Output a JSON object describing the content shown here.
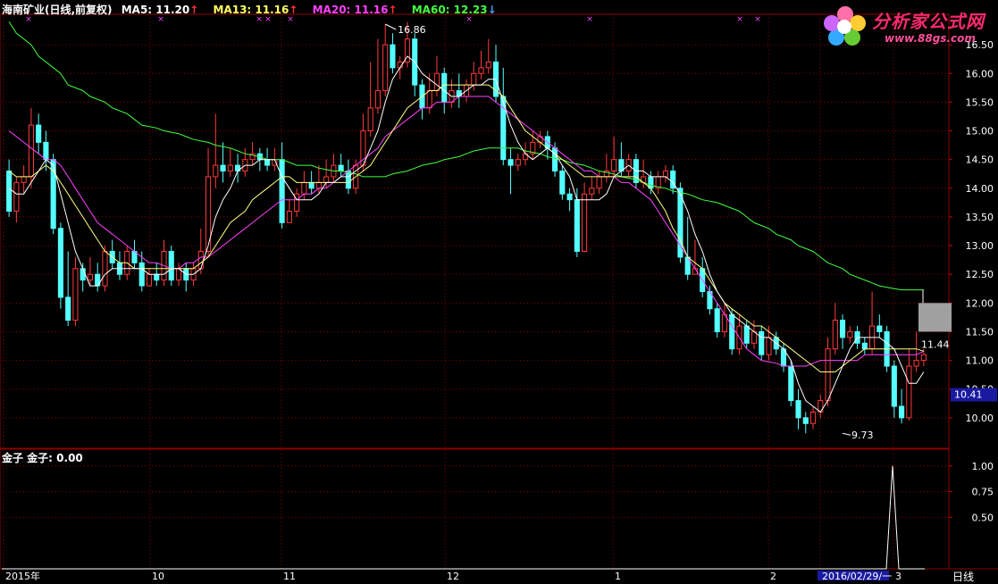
{
  "header": {
    "title": "海南矿业(日线,前复权)",
    "ma5_label": "MA5: 11.20",
    "ma13_label": "MA13: 11.16",
    "ma20_label": "MA20: 11.16",
    "ma60_label": "MA60: 12.23"
  },
  "logo": {
    "text": "分析家公式网",
    "url": "www.88gs.com"
  },
  "sub_indicator": {
    "label": "金子  金子: 0.00"
  },
  "period_label": "日线",
  "colors": {
    "up": "#ff3a3a",
    "down": "#54ffff",
    "ma5": "#ffffff",
    "ma13": "#ffff80",
    "ma20": "#ff40ff",
    "ma60": "#40ff40",
    "grid": "#8b0000",
    "axis_text": "#ffffff"
  },
  "chart_data": [
    {
      "type": "candlestick",
      "title": "海南矿业(日线,前复权)",
      "ylim": [
        9.5,
        17.0
      ],
      "y_ticks": [
        "10.00",
        "10.50",
        "11.00",
        "11.50",
        "12.00",
        "12.50",
        "13.00",
        "13.50",
        "14.00",
        "14.50",
        "15.00",
        "15.50",
        "16.00",
        "16.50"
      ],
      "x_ticks": [
        "2015年",
        "10",
        "11",
        "12",
        "1",
        "2",
        "2016/02/29/一",
        "3"
      ],
      "annotations": [
        {
          "text": "16.86",
          "value": 16.86
        },
        {
          "text": "9.73",
          "value": 9.73
        },
        {
          "text": "11.44",
          "value": 11.44
        }
      ],
      "price_box": "10.41",
      "candles": [
        [
          14.3,
          13.6,
          14.5,
          13.5
        ],
        [
          13.6,
          14.1,
          14.2,
          13.4
        ],
        [
          14.1,
          14.2,
          14.4,
          13.9
        ],
        [
          14.2,
          15.1,
          15.4,
          14.0
        ],
        [
          15.1,
          14.8,
          15.3,
          14.6
        ],
        [
          14.8,
          14.5,
          15.0,
          14.3
        ],
        [
          14.5,
          13.3,
          14.6,
          13.2
        ],
        [
          13.3,
          12.1,
          13.4,
          11.9
        ],
        [
          12.1,
          11.7,
          12.9,
          11.6
        ],
        [
          11.7,
          12.6,
          12.8,
          11.6
        ],
        [
          12.6,
          12.4,
          12.7,
          12.2
        ],
        [
          12.4,
          12.5,
          12.8,
          12.3
        ],
        [
          12.5,
          12.3,
          12.7,
          12.2
        ],
        [
          12.3,
          12.9,
          13.0,
          12.2
        ],
        [
          12.9,
          12.7,
          13.1,
          12.6
        ],
        [
          12.7,
          12.5,
          12.9,
          12.4
        ],
        [
          12.5,
          12.9,
          13.0,
          12.4
        ],
        [
          12.9,
          12.7,
          13.1,
          12.6
        ],
        [
          12.7,
          12.3,
          12.9,
          12.2
        ],
        [
          12.3,
          12.5,
          12.6,
          12.3
        ],
        [
          12.5,
          12.4,
          12.7,
          12.3
        ],
        [
          12.4,
          12.9,
          13.1,
          12.3
        ],
        [
          12.9,
          12.4,
          13.0,
          12.3
        ],
        [
          12.4,
          12.6,
          12.7,
          12.3
        ],
        [
          12.6,
          12.4,
          12.7,
          12.2
        ],
        [
          12.4,
          12.6,
          12.7,
          12.3
        ],
        [
          12.6,
          12.9,
          13.3,
          12.5
        ],
        [
          12.9,
          14.2,
          14.7,
          12.8
        ],
        [
          14.2,
          14.4,
          15.3,
          14.0
        ],
        [
          14.4,
          14.3,
          14.8,
          14.1
        ],
        [
          14.3,
          14.4,
          14.7,
          14.2
        ],
        [
          14.4,
          14.3,
          14.6,
          14.1
        ],
        [
          14.3,
          14.5,
          14.7,
          14.2
        ],
        [
          14.5,
          14.6,
          14.8,
          14.4
        ],
        [
          14.6,
          14.5,
          14.7,
          14.3
        ],
        [
          14.5,
          14.4,
          14.7,
          14.3
        ],
        [
          14.4,
          14.5,
          14.7,
          14.3
        ],
        [
          14.5,
          13.4,
          14.8,
          13.3
        ],
        [
          13.4,
          13.6,
          13.8,
          13.4
        ],
        [
          13.6,
          13.9,
          14.0,
          13.5
        ],
        [
          13.9,
          14.1,
          14.3,
          13.8
        ],
        [
          14.1,
          14.0,
          14.3,
          13.9
        ],
        [
          14.0,
          14.1,
          14.4,
          13.9
        ],
        [
          14.1,
          14.2,
          14.5,
          14.0
        ],
        [
          14.2,
          14.4,
          14.6,
          14.1
        ],
        [
          14.4,
          14.3,
          14.6,
          14.2
        ],
        [
          14.3,
          14.0,
          14.5,
          13.9
        ],
        [
          14.0,
          14.4,
          14.5,
          13.9
        ],
        [
          14.4,
          15.0,
          15.3,
          14.3
        ],
        [
          15.0,
          15.4,
          16.2,
          14.9
        ],
        [
          15.4,
          15.7,
          16.6,
          15.3
        ],
        [
          15.7,
          16.5,
          16.86,
          15.6
        ],
        [
          16.5,
          16.1,
          16.7,
          16.0
        ],
        [
          16.1,
          16.2,
          16.3,
          15.9
        ],
        [
          16.2,
          16.6,
          16.9,
          16.1
        ],
        [
          16.6,
          15.8,
          16.7,
          15.6
        ],
        [
          15.8,
          15.4,
          15.9,
          15.2
        ],
        [
          15.4,
          15.7,
          16.0,
          15.3
        ],
        [
          15.7,
          16.0,
          16.3,
          15.6
        ],
        [
          16.0,
          15.5,
          16.1,
          15.3
        ],
        [
          15.5,
          15.7,
          15.9,
          15.4
        ],
        [
          15.7,
          15.6,
          16.0,
          15.4
        ],
        [
          15.6,
          15.8,
          15.9,
          15.5
        ],
        [
          15.8,
          16.0,
          16.2,
          15.7
        ],
        [
          16.0,
          16.1,
          16.4,
          15.9
        ],
        [
          16.1,
          16.2,
          16.6,
          16.0
        ],
        [
          16.2,
          15.6,
          16.5,
          15.5
        ],
        [
          15.6,
          14.5,
          16.1,
          14.4
        ],
        [
          14.5,
          14.4,
          14.7,
          13.9
        ],
        [
          14.4,
          14.5,
          14.6,
          14.3
        ],
        [
          14.5,
          14.6,
          14.8,
          14.4
        ],
        [
          14.6,
          14.8,
          15.0,
          14.5
        ],
        [
          14.8,
          14.9,
          15.0,
          14.7
        ],
        [
          14.9,
          14.7,
          15.0,
          14.5
        ],
        [
          14.7,
          14.3,
          14.8,
          14.2
        ],
        [
          14.3,
          13.9,
          14.4,
          13.8
        ],
        [
          13.9,
          13.8,
          14.0,
          13.6
        ],
        [
          13.8,
          12.9,
          14.0,
          12.8
        ],
        [
          12.9,
          13.9,
          14.1,
          12.9
        ],
        [
          13.9,
          14.0,
          14.2,
          13.8
        ],
        [
          14.0,
          14.2,
          14.3,
          13.9
        ],
        [
          14.2,
          14.3,
          14.6,
          14.1
        ],
        [
          14.3,
          14.5,
          14.9,
          14.2
        ],
        [
          14.5,
          14.3,
          14.8,
          14.2
        ],
        [
          14.3,
          14.5,
          14.6,
          14.2
        ],
        [
          14.5,
          14.1,
          14.6,
          14.0
        ],
        [
          14.1,
          14.2,
          14.5,
          14.0
        ],
        [
          14.2,
          14.0,
          14.3,
          13.9
        ],
        [
          14.0,
          14.2,
          14.3,
          13.9
        ],
        [
          14.2,
          14.3,
          14.4,
          14.1
        ],
        [
          14.3,
          14.0,
          14.4,
          13.9
        ],
        [
          14.0,
          12.8,
          14.1,
          12.7
        ],
        [
          12.8,
          12.5,
          13.5,
          12.4
        ],
        [
          12.5,
          12.6,
          13.1,
          12.5
        ],
        [
          12.6,
          12.2,
          12.8,
          12.1
        ],
        [
          12.2,
          11.9,
          12.3,
          11.8
        ],
        [
          11.9,
          11.5,
          12.0,
          11.4
        ],
        [
          11.5,
          11.8,
          12.0,
          11.4
        ],
        [
          11.8,
          11.2,
          11.9,
          11.1
        ],
        [
          11.2,
          11.6,
          11.8,
          11.1
        ],
        [
          11.6,
          11.3,
          11.7,
          11.2
        ],
        [
          11.3,
          11.5,
          11.7,
          11.2
        ],
        [
          11.5,
          11.1,
          11.6,
          11.0
        ],
        [
          11.1,
          11.4,
          11.6,
          11.0
        ],
        [
          11.4,
          11.2,
          11.5,
          11.1
        ],
        [
          11.2,
          10.9,
          11.3,
          10.8
        ],
        [
          10.9,
          10.3,
          11.0,
          10.2
        ],
        [
          10.3,
          10.0,
          10.5,
          9.8
        ],
        [
          10.0,
          9.9,
          10.1,
          9.73
        ],
        [
          9.9,
          10.1,
          10.2,
          9.8
        ],
        [
          10.1,
          10.3,
          10.4,
          10.0
        ],
        [
          10.3,
          11.2,
          11.4,
          10.2
        ],
        [
          11.2,
          11.7,
          12.0,
          11.1
        ],
        [
          11.7,
          11.4,
          11.8,
          11.2
        ],
        [
          11.4,
          11.5,
          11.6,
          11.3
        ],
        [
          11.5,
          11.3,
          11.6,
          11.2
        ],
        [
          11.3,
          11.2,
          11.4,
          11.1
        ],
        [
          11.2,
          11.6,
          12.2,
          11.1
        ],
        [
          11.6,
          11.5,
          11.8,
          11.4
        ],
        [
          11.5,
          10.9,
          11.6,
          10.8
        ],
        [
          10.9,
          10.2,
          11.0,
          10.0
        ],
        [
          10.2,
          10.0,
          10.5,
          9.9
        ],
        [
          10.0,
          10.9,
          11.2,
          9.95
        ],
        [
          10.9,
          11.0,
          11.5,
          10.8
        ],
        [
          11.0,
          11.1,
          11.2,
          10.9
        ]
      ],
      "ma5": [
        14.0,
        13.9,
        13.9,
        14.1,
        14.3,
        14.5,
        14.4,
        13.9,
        13.4,
        12.9,
        12.6,
        12.3,
        12.3,
        12.5,
        12.6,
        12.6,
        12.6,
        12.6,
        12.6,
        12.5,
        12.5,
        12.5,
        12.6,
        12.6,
        12.5,
        12.5,
        12.6,
        13.0,
        13.5,
        13.8,
        14.0,
        14.3,
        14.4,
        14.4,
        14.5,
        14.5,
        14.5,
        14.2,
        14.0,
        13.8,
        13.8,
        13.8,
        13.9,
        14.1,
        14.1,
        14.2,
        14.2,
        14.3,
        14.4,
        14.7,
        15.0,
        15.5,
        15.9,
        16.1,
        16.3,
        16.2,
        16.0,
        15.9,
        15.8,
        15.7,
        15.6,
        15.6,
        15.7,
        15.8,
        15.8,
        15.9,
        15.9,
        15.5,
        15.1,
        14.8,
        14.6,
        14.5,
        14.6,
        14.7,
        14.6,
        14.4,
        14.2,
        13.8,
        13.8,
        13.8,
        13.8,
        13.9,
        14.2,
        14.3,
        14.4,
        14.3,
        14.3,
        14.2,
        14.2,
        14.2,
        14.1,
        13.9,
        13.6,
        13.2,
        12.9,
        12.5,
        12.2,
        12.0,
        11.8,
        11.7,
        11.6,
        11.5,
        11.4,
        11.4,
        11.3,
        11.2,
        11.0,
        10.6,
        10.3,
        10.2,
        10.1,
        10.3,
        10.6,
        10.9,
        11.2,
        11.4,
        11.4,
        11.4,
        11.4,
        11.3,
        11.2,
        10.9,
        10.6,
        10.6,
        10.8
      ],
      "ma13": [
        14.3,
        14.2,
        14.2,
        14.2,
        14.3,
        14.4,
        14.3,
        14.1,
        13.9,
        13.7,
        13.5,
        13.3,
        13.1,
        12.9,
        12.8,
        12.7,
        12.7,
        12.6,
        12.6,
        12.6,
        12.6,
        12.6,
        12.6,
        12.6,
        12.6,
        12.6,
        12.7,
        12.8,
        13.0,
        13.2,
        13.4,
        13.6,
        13.8,
        13.9,
        14.0,
        14.1,
        14.2,
        14.2,
        14.1,
        14.1,
        14.1,
        14.1,
        14.1,
        14.1,
        14.1,
        14.1,
        14.2,
        14.3,
        14.4,
        14.6,
        14.8,
        15.0,
        15.2,
        15.4,
        15.5,
        15.6,
        15.7,
        15.7,
        15.8,
        15.8,
        15.8,
        15.8,
        15.8,
        15.8,
        15.8,
        15.7,
        15.6,
        15.4,
        15.2,
        15.0,
        14.9,
        14.8,
        14.7,
        14.6,
        14.5,
        14.4,
        14.3,
        14.2,
        14.2,
        14.2,
        14.2,
        14.2,
        14.2,
        14.2,
        14.2,
        14.1,
        14.0,
        13.8,
        13.6,
        13.3,
        13.1,
        12.8,
        12.6,
        12.4,
        12.2,
        12.0,
        11.9,
        11.8,
        11.7,
        11.6,
        11.6,
        11.5,
        11.4,
        11.3,
        11.2,
        11.1,
        11.0,
        10.9,
        10.8,
        10.8,
        10.8,
        10.9,
        11.0,
        11.1,
        11.2,
        11.2,
        11.2,
        11.2,
        11.2,
        11.2,
        11.2,
        11.2,
        11.16
      ],
      "ma20": [
        15.0,
        14.9,
        14.8,
        14.7,
        14.6,
        14.5,
        14.5,
        14.4,
        14.2,
        14.0,
        13.8,
        13.6,
        13.4,
        13.3,
        13.2,
        13.1,
        13.0,
        12.9,
        12.8,
        12.7,
        12.7,
        12.6,
        12.6,
        12.7,
        12.7,
        12.8,
        12.8,
        12.9,
        13.0,
        13.1,
        13.2,
        13.3,
        13.4,
        13.5,
        13.6,
        13.7,
        13.8,
        13.8,
        13.8,
        13.9,
        13.9,
        14.0,
        14.0,
        14.1,
        14.2,
        14.3,
        14.4,
        14.5,
        14.6,
        14.7,
        14.9,
        15.0,
        15.1,
        15.2,
        15.3,
        15.4,
        15.4,
        15.5,
        15.5,
        15.5,
        15.6,
        15.6,
        15.6,
        15.6,
        15.5,
        15.4,
        15.3,
        15.2,
        15.1,
        15.0,
        14.9,
        14.8,
        14.7,
        14.6,
        14.5,
        14.4,
        14.3,
        14.3,
        14.2,
        14.2,
        14.2,
        14.1,
        14.1,
        14.0,
        13.9,
        13.8,
        13.6,
        13.4,
        13.2,
        13.0,
        12.8,
        12.6,
        12.4,
        12.2,
        12.0,
        11.8,
        11.6,
        11.4,
        11.2,
        11.1,
        11.0,
        10.95,
        10.9,
        10.9,
        10.9,
        10.9,
        10.95,
        11.0,
        11.0,
        11.0,
        11.0,
        11.0,
        11.0,
        11.1,
        11.1,
        11.1,
        11.1,
        11.1,
        11.1,
        11.1,
        11.1,
        11.16
      ],
      "ma60": [
        16.9,
        16.7,
        16.5,
        16.3,
        16.1,
        16.0,
        15.8,
        15.7,
        15.6,
        15.5,
        15.4,
        15.3,
        15.2,
        15.1,
        15.05,
        15.0,
        14.95,
        14.9,
        14.85,
        14.8,
        14.75,
        14.7,
        14.65,
        14.6,
        14.55,
        14.5,
        14.5,
        14.45,
        14.4,
        14.4,
        14.35,
        14.3,
        14.3,
        14.25,
        14.2,
        14.2,
        14.2,
        14.25,
        14.3,
        14.35,
        14.4,
        14.45,
        14.5,
        14.55,
        14.6,
        14.65,
        14.7,
        14.7,
        14.7,
        14.7,
        14.65,
        14.6,
        14.55,
        14.5,
        14.45,
        14.4,
        14.35,
        14.3,
        14.25,
        14.2,
        14.15,
        14.1,
        14.05,
        14.0,
        13.95,
        13.9,
        13.85,
        13.8,
        13.75,
        13.7,
        13.6,
        13.5,
        13.4,
        13.3,
        13.2,
        13.1,
        13.0,
        12.9,
        12.8,
        12.7,
        12.6,
        12.5,
        12.4,
        12.35,
        12.3,
        12.25,
        12.23,
        12.23,
        12.23
      ]
    },
    {
      "type": "line",
      "title": "金子",
      "ylim": [
        0,
        1.05
      ],
      "y_ticks": [
        "0.50",
        "0.75",
        "1.00"
      ],
      "signal_index": 122,
      "value": 1.0
    }
  ]
}
